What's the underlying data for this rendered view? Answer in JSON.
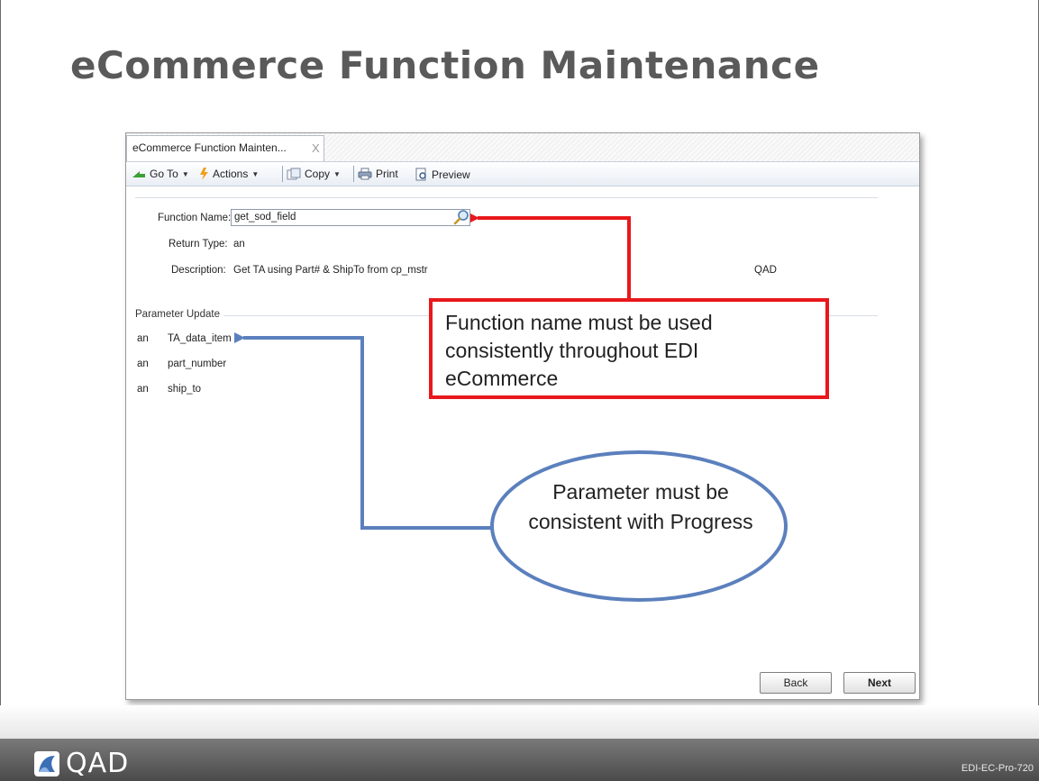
{
  "slide": {
    "title": "eCommerce Function Maintenance",
    "footer_logo_text": "QAD",
    "footer_code": "EDI-EC-Pro-720"
  },
  "window": {
    "tab_label": "eCommerce Function Mainten...",
    "tab_close": "X",
    "toolbar": {
      "goto_label": "Go To",
      "actions_label": "Actions",
      "copy_label": "Copy",
      "print_label": "Print",
      "preview_label": "Preview"
    },
    "form": {
      "function_name_label": "Function Name:",
      "function_name_value": "get_sod_field",
      "return_type_label": "Return Type:",
      "return_type_value": "an",
      "description_label": "Description:",
      "description_value": "Get TA using Part# & ShipTo from cp_mstr",
      "owner_value": "QAD"
    },
    "parameters": {
      "section_title": "Parameter Update",
      "items": [
        {
          "type": "an",
          "name": "TA_data_item"
        },
        {
          "type": "an",
          "name": "part_number"
        },
        {
          "type": "an",
          "name": "ship_to"
        }
      ]
    },
    "buttons": {
      "back_label": "Back",
      "next_label": "Next"
    }
  },
  "callouts": {
    "function_name_note": "Function name must be used consistently throughout EDI eCommerce",
    "parameter_note": "Parameter must be consistent with Progress"
  },
  "colors": {
    "callout_red": "#e8181c",
    "callout_blue": "#5b80bd",
    "title_gray": "#5a5a5a",
    "footer_gray": "#4a4a4a"
  },
  "icons": [
    "goto-icon",
    "actions-icon",
    "copy-icon",
    "print-icon",
    "preview-icon",
    "lookup-icon",
    "qad-logo-icon"
  ]
}
